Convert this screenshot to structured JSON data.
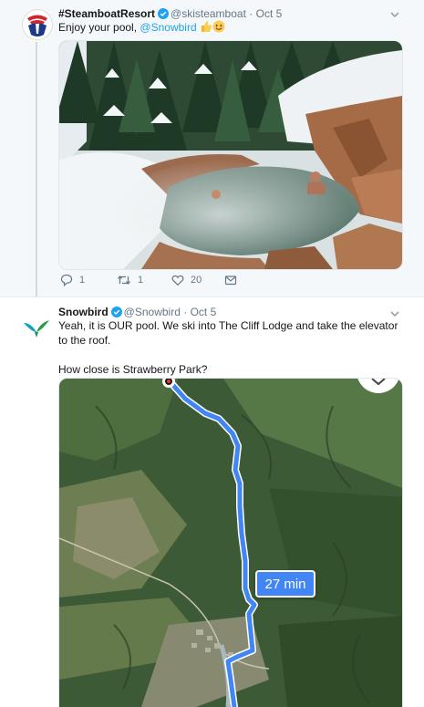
{
  "tweet1": {
    "display_name": "#SteamboatResort",
    "handle": "@skisteamboat",
    "separator": "·",
    "date": "Oct 5",
    "text_prefix": "Enjoy your pool,",
    "mention": "@Snowbird",
    "emoji": [
      "thumbs-up-emoji",
      "smiling-face-emoji"
    ],
    "replies": "1",
    "retweets": "1",
    "likes": "20"
  },
  "tweet2": {
    "display_name": "Snowbird",
    "handle": "@Snowbird",
    "separator": "·",
    "date": "Oct 5",
    "text_line1": "Yeah, it is OUR pool. We ski into The Cliff Lodge and take the elevator to the roof.",
    "text_line2": "How close is Strawberry Park?",
    "route_label": "27 min"
  },
  "colors": {
    "accent": "#1da1f2",
    "route": "#4285f4",
    "verified": "#1da1f2"
  }
}
